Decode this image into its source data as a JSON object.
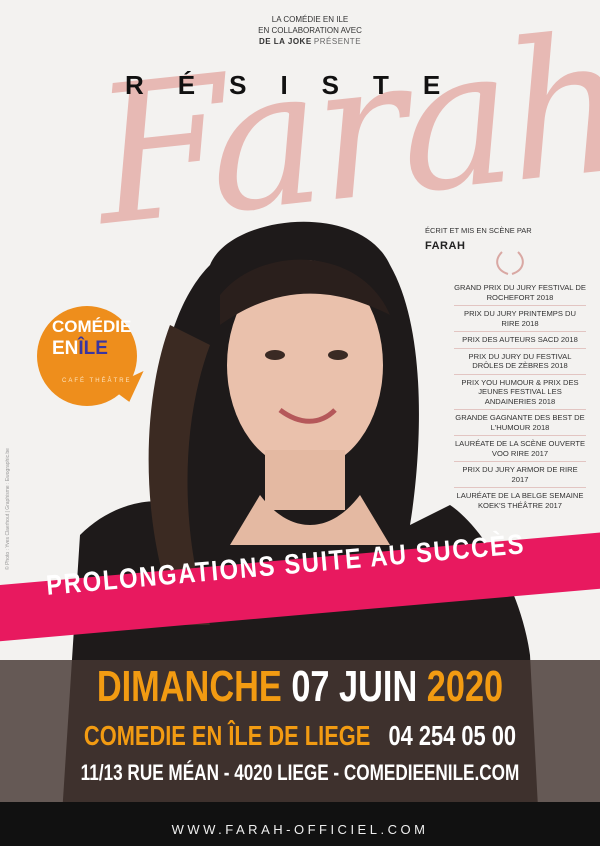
{
  "intro": {
    "line1": "LA COMÉDIE EN ILE",
    "line2": "EN COLLABORATION AVEC",
    "line3_org": "DE LA JOKE",
    "line3_verb": "PRÉSENTE"
  },
  "title": {
    "resiste": "RÉSISTE",
    "name": "Farah"
  },
  "credits": {
    "written_by": "ÉCRIT ET MIS EN SCÈNE PAR",
    "author": "FARAH"
  },
  "awards": [
    "GRAND PRIX DU JURY FESTIVAL DE ROCHEFORT 2018",
    "PRIX DU JURY PRINTEMPS DU RIRE 2018",
    "PRIX DES AUTEURS SACD 2018",
    "PRIX DU JURY DU FESTIVAL DRÔLES DE ZÈBRES 2018",
    "PRIX YOU HUMOUR & PRIX DES JEUNES FESTIVAL LES ANDAINERIES 2018",
    "GRANDE GAGNANTE DES BEST DE L'HUMOUR 2018",
    "LAURÉATE DE LA SCÈNE OUVERTE VOO RIRE 2017",
    "PRIX DU JURY ARMOR DE RIRE 2017",
    "LAURÉATE DE LA BELGE SEMAINE KOEK'S THÉÂTRE 2017"
  ],
  "logo": {
    "line1": "COMÉDIE",
    "line2a": "EN",
    "line2b": "ÎLE",
    "line3": "CAFÉ THÉÂTRE"
  },
  "photo_credit": "© Photo : Yves Claerhout | Graphisme : Ewographic.be",
  "banner": "PROLONGATIONS SUITE AU SUCCÈS",
  "event": {
    "day": "DIMANCHE",
    "date": "07 JUIN",
    "year": "2020",
    "venue": "COMEDIE EN ÎLE DE LIEGE",
    "phone": "04 254 05 00",
    "address": "11/13 RUE MÉAN - 4020 LIEGE - COMEDIEENILE.COM"
  },
  "website": "WWW.FARAH-OFFICIEL.COM",
  "colors": {
    "accent_pink": "#e8195f",
    "orange": "#f29b12",
    "script_pink": "#e6b3ae",
    "logo_orange": "#ee8e1c"
  }
}
